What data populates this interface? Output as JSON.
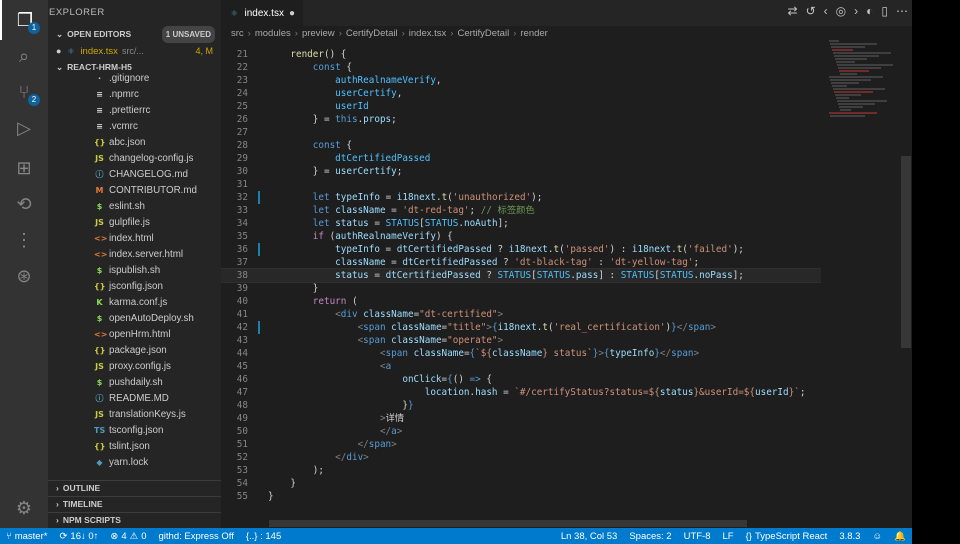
{
  "activity_bar": {
    "explorer_badge": "1",
    "scm_badge": "2"
  },
  "sidebar": {
    "title": "EXPLORER",
    "open_editors": {
      "header": "OPEN EDITORS",
      "unsaved": "1 UNSAVED",
      "file_name": "index.tsx",
      "file_path": "src/...",
      "file_problems": "4, M"
    },
    "project": {
      "header": "REACT-HRM-H5",
      "files": [
        {
          "name": ".gitignore",
          "icon": "·",
          "color": "#cccccc"
        },
        {
          "name": ".npmrc",
          "icon": "≡",
          "color": "#cccccc"
        },
        {
          "name": ".prettierrc",
          "icon": "≡",
          "color": "#cccccc"
        },
        {
          "name": ".vcmrc",
          "icon": "≡",
          "color": "#cccccc"
        },
        {
          "name": "abc.json",
          "icon": "{}",
          "color": "#cbcb41"
        },
        {
          "name": "changelog-config.js",
          "icon": "JS",
          "color": "#cbcb41"
        },
        {
          "name": "CHANGELOG.md",
          "icon": "ⓘ",
          "color": "#519aba"
        },
        {
          "name": "CONTRIBUTOR.md",
          "icon": "M",
          "color": "#e37933"
        },
        {
          "name": "eslint.sh",
          "icon": "$",
          "color": "#89e051"
        },
        {
          "name": "gulpfile.js",
          "icon": "JS",
          "color": "#cbcb41"
        },
        {
          "name": "index.html",
          "icon": "<>",
          "color": "#e37933"
        },
        {
          "name": "index.server.html",
          "icon": "<>",
          "color": "#e37933"
        },
        {
          "name": "ispublish.sh",
          "icon": "$",
          "color": "#89e051"
        },
        {
          "name": "jsconfig.json",
          "icon": "{}",
          "color": "#cbcb41"
        },
        {
          "name": "karma.conf.js",
          "icon": "K",
          "color": "#89e051"
        },
        {
          "name": "openAutoDeploy.sh",
          "icon": "$",
          "color": "#89e051"
        },
        {
          "name": "openHrm.html",
          "icon": "<>",
          "color": "#e37933"
        },
        {
          "name": "package.json",
          "icon": "{}",
          "color": "#cbcb41"
        },
        {
          "name": "proxy.config.js",
          "icon": "JS",
          "color": "#cbcb41"
        },
        {
          "name": "pushdaily.sh",
          "icon": "$",
          "color": "#89e051"
        },
        {
          "name": "README.MD",
          "icon": "ⓘ",
          "color": "#519aba"
        },
        {
          "name": "translationKeys.js",
          "icon": "JS",
          "color": "#cbcb41"
        },
        {
          "name": "tsconfig.json",
          "icon": "TS",
          "color": "#519aba"
        },
        {
          "name": "tslint.json",
          "icon": "{}",
          "color": "#cbcb41"
        },
        {
          "name": "yarn.lock",
          "icon": "◆",
          "color": "#519aba"
        }
      ]
    },
    "outline": "OUTLINE",
    "timeline": "TIMELINE",
    "npm_scripts": "NPM SCRIPTS"
  },
  "editor": {
    "tab_label": "index.tsx",
    "breadcrumb": [
      "src",
      "modules",
      "preview",
      "CertifyDetail",
      "index.tsx",
      "CertifyDetail",
      "render"
    ],
    "first_line": 21,
    "current_line": 38,
    "modified_lines": [
      32,
      36,
      42
    ]
  },
  "statusbar": {
    "branch": "master*",
    "sync": "16↓ 0↑",
    "errors": "4",
    "warnings": "0",
    "githd": "githd: Express Off",
    "braces": "{..} : 145",
    "position": "Ln 38, Col 53",
    "spaces": "Spaces: 2",
    "encoding": "UTF-8",
    "eol": "LF",
    "language": "TypeScript React",
    "version": "3.8.3"
  }
}
